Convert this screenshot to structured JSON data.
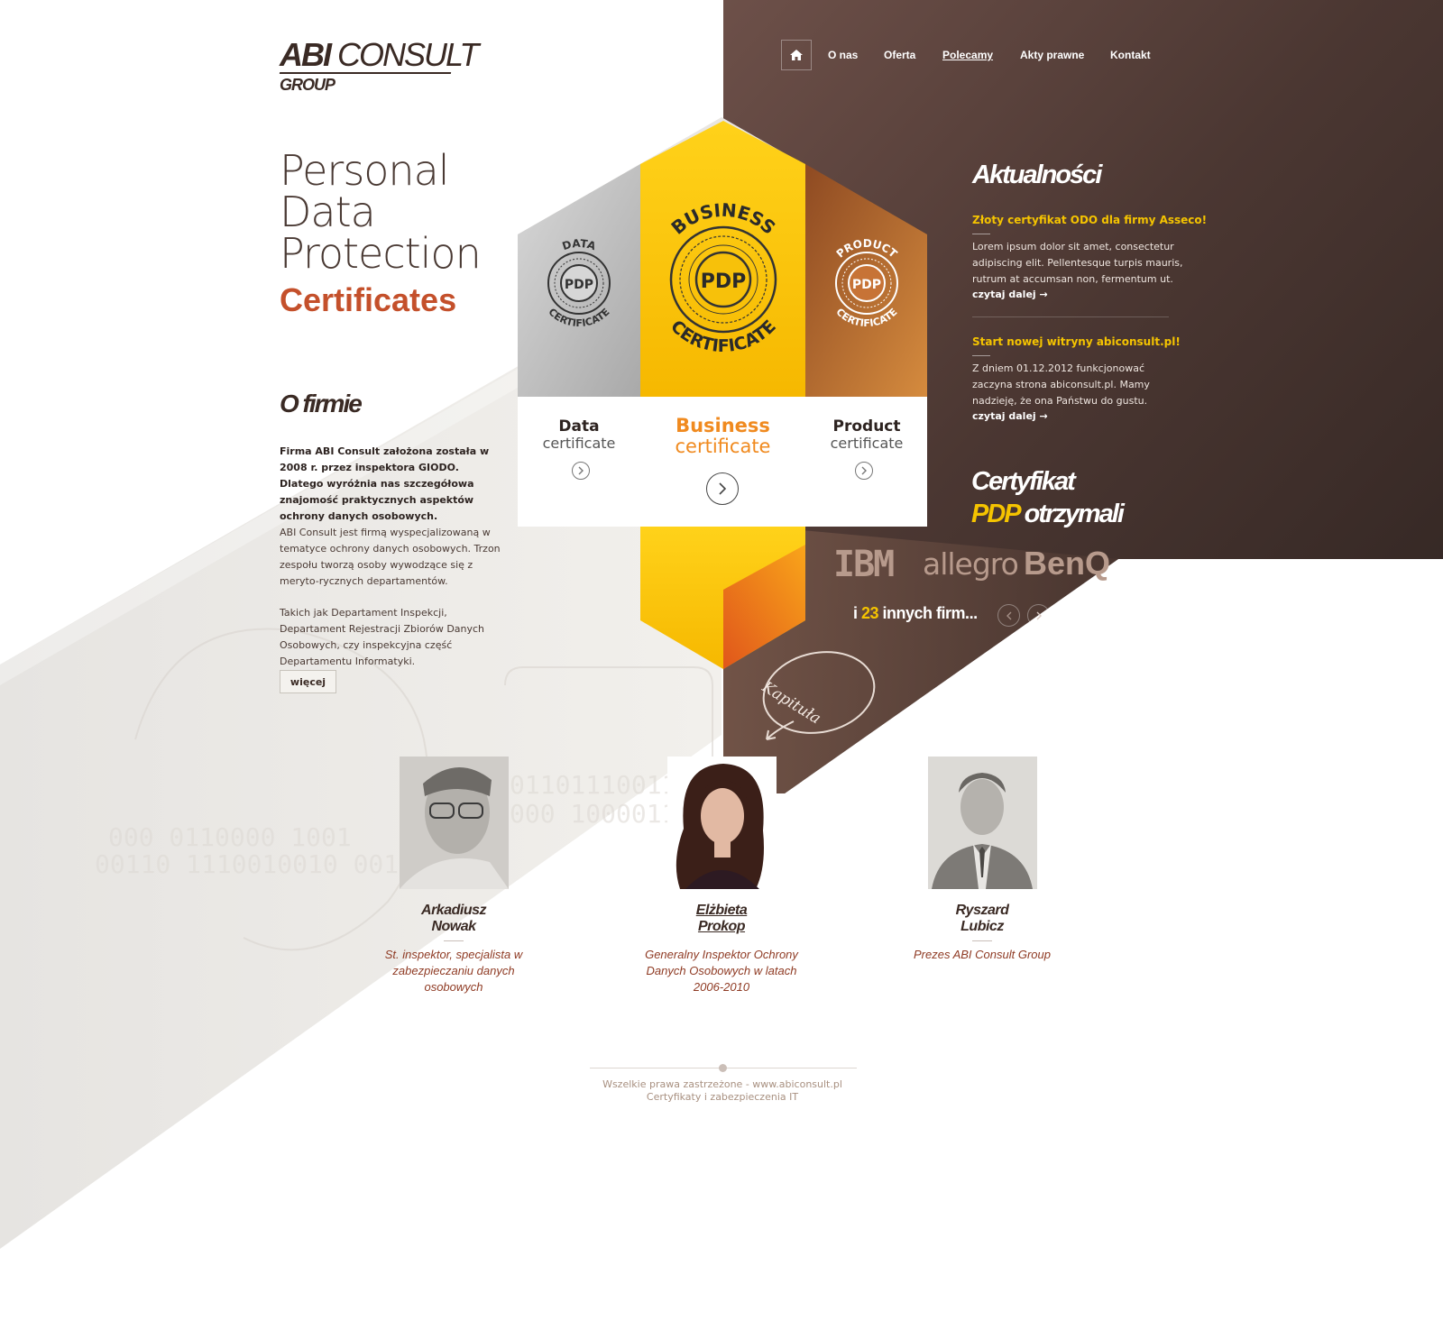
{
  "logo": {
    "bold": "ABI",
    "light": " CONSULT",
    "sub": "GROUP"
  },
  "nav": {
    "home_icon": "home-icon",
    "items": [
      "O nas",
      "Oferta",
      "Polecamy",
      "Akty prawne",
      "Kontakt"
    ],
    "active": "Polecamy"
  },
  "hero": {
    "line1": "Personal",
    "line2": "Data",
    "line3": "Protection",
    "accent": "Certificates"
  },
  "certs": [
    {
      "seal_top": "DATA",
      "seal_mid": "PDP",
      "seal_bottom": "CERTIFICATE",
      "name": "Data",
      "sub": "certificate"
    },
    {
      "seal_top": "BUSINESS",
      "seal_mid": "PDP",
      "seal_bottom": "CERTIFICATE",
      "name": "Business",
      "sub": "certificate"
    },
    {
      "seal_top": "PRODUCT",
      "seal_mid": "PDP",
      "seal_bottom": "CERTIFICATE",
      "name": "Product",
      "sub": "certificate"
    }
  ],
  "about": {
    "heading": "O firmie",
    "p1": "Firma ABI Consult założona została w 2008 r. przez inspektora GIODO. Dlatego wyróżnia nas szczegółowa znajomość praktycznych aspektów ochrony danych osobowych.",
    "p2": "ABI Consult jest firmą wyspecjalizowaną w tematyce ochrony danych osobowych. Trzon zespołu tworzą osoby wywodzące się z meryto-rycznych departamentów.",
    "p3": "Takich jak Departament Inspekcji, Departament Rejestracji Zbiorów Danych Osobowych, czy inspekcyjna część Departamentu Informatyki.",
    "more": "więcej"
  },
  "news": {
    "heading": "Aktualności",
    "items": [
      {
        "title": "Złoty certyfikat ODO dla firmy Asseco!",
        "body": "Lorem ipsum dolor sit amet, consectetur adipiscing elit. Pellentesque turpis mauris, rutrum at accumsan non, fermentum ut.",
        "more": "czytaj dalej  →"
      },
      {
        "title": "Start nowej witryny abiconsult.pl!",
        "body": "Z dniem 01.12.2012 funkcjonować zaczyna strona abiconsult.pl. Mamy nadzieję, że ona Państwu do gustu.",
        "more": "czytaj dalej  →"
      }
    ]
  },
  "certified": {
    "line1": "Certyfikat",
    "line2_accent": "PDP",
    "line2_rest": " otrzymali",
    "logos": [
      "IBM",
      "allegro",
      "BenQ"
    ],
    "more_prefix": "i ",
    "more_count": "23",
    "more_suffix": " innych firm..."
  },
  "kapitula": "Kapituła",
  "team": [
    {
      "first": "Arkadiusz",
      "last": "Nowak",
      "role": "St. inspektor, specjalista w zabezpieczaniu danych osobowych"
    },
    {
      "first": "Elżbieta",
      "last": "Prokop",
      "role": "Generalny Inspektor Ochrony Danych Osobowych w latach 2006-2010"
    },
    {
      "first": "Ryszard",
      "last": "Lubicz",
      "role": "Prezes ABI Consult Group"
    }
  ],
  "footer": {
    "line1": "Wszelkie prawa zastrzeżone - www.abiconsult.pl",
    "line2": "Certyfikaty i zabezpieczenia IT"
  },
  "colors": {
    "brown_dark": "#3a2a26",
    "brown_mid": "#6e5047",
    "accent_orange": "#c4502b",
    "accent_yellow": "#f5c400",
    "silver": "#b9b9b9",
    "copper": "#a4562a"
  }
}
